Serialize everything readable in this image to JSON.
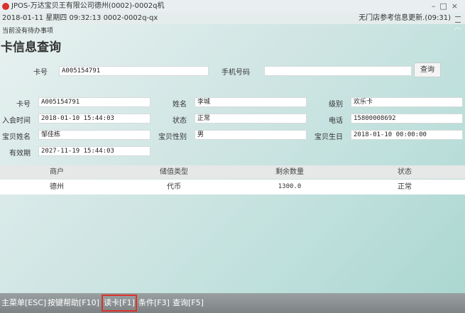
{
  "titlebar": {
    "title": "JPOS-万达宝贝王有限公司德州(0002)-0002q机"
  },
  "statusline": {
    "left": "2018-01-11 星期四 09:32:13 0002-0002q-qx",
    "right": "无门店参考信息更新.(09:31)"
  },
  "todo": "当前没有待办事项",
  "page_title": "卡信息查询",
  "search": {
    "card_label": "卡号",
    "card_value": "A005154791",
    "phone_label": "手机号码",
    "phone_value": "",
    "query_button": "查询"
  },
  "info": {
    "card_no": {
      "label": "卡号",
      "value": "A005154791"
    },
    "name": {
      "label": "姓名",
      "value": "李城"
    },
    "level": {
      "label": "级别",
      "value": "欢乐卡"
    },
    "join_time": {
      "label": "入会时间",
      "value": "2018-01-10 15:44:03"
    },
    "status": {
      "label": "状态",
      "value": "正常"
    },
    "phone": {
      "label": "电话",
      "value": "15800008692"
    },
    "baby_name": {
      "label": "宝贝姓名",
      "value": "邹佳栋"
    },
    "baby_gender": {
      "label": "宝贝性别",
      "value": "男"
    },
    "baby_birthday": {
      "label": "宝贝生日",
      "value": "2018-01-10 00:00:00"
    },
    "expiry": {
      "label": "有效期",
      "value": "2027-11-19 15:44:03"
    }
  },
  "table": {
    "headers": [
      "商户",
      "储值类型",
      "剩余数量",
      "状态"
    ],
    "rows": [
      [
        "德州",
        "代币",
        "1300.0",
        "正常"
      ]
    ]
  },
  "bottom": [
    "主菜单[ESC]",
    "按键帮助[F10]",
    "读卡[F1]",
    "条件[F3]",
    "查询[F5]"
  ],
  "colors": {
    "highlight": "#d9342b"
  }
}
